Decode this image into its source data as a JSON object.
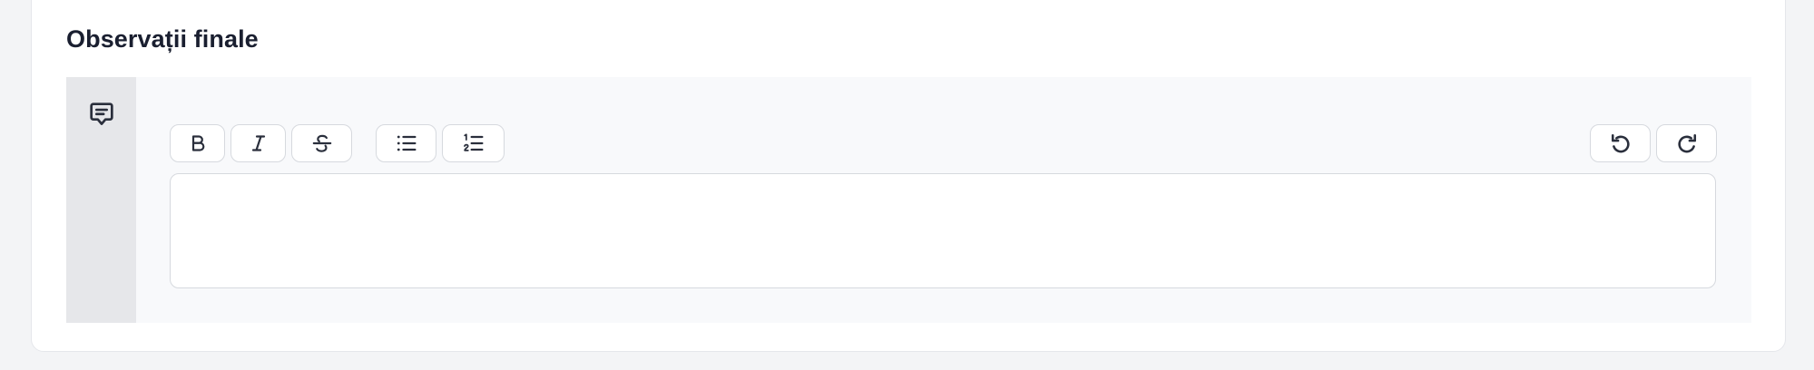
{
  "section": {
    "title": "Observații finale"
  },
  "field": {
    "icon": "comment-icon",
    "editor_value": ""
  },
  "toolbar": {
    "left_groups": [
      [
        "bold-icon",
        "italic-icon",
        "strikethrough-icon"
      ],
      [
        "bullet-list-icon",
        "numbered-list-icon"
      ]
    ],
    "right_group": [
      "undo-icon",
      "redo-icon"
    ]
  },
  "colors": {
    "page_bg": "#f3f4f6",
    "card_bg": "#ffffff",
    "field_bg": "#f8f9fb",
    "rail_bg": "#e6e7ea",
    "border": "#d6d9de",
    "text": "#1a1f30",
    "icon": "#2a2f3c"
  }
}
